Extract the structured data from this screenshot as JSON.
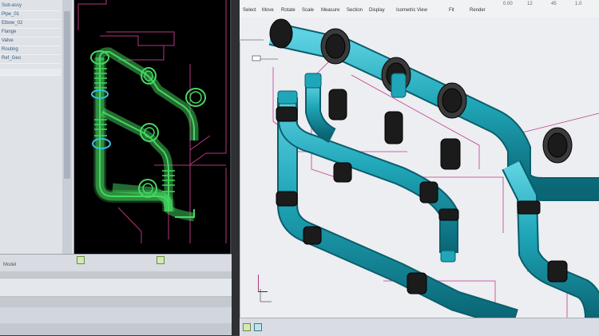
{
  "tree_panel": {
    "rows": [
      "Sub-assy",
      "Pipe_01",
      "Elbow_02",
      "Flange",
      "Valve",
      "Routing",
      "Ref_Geo"
    ],
    "bottom_text": "Model"
  },
  "viewport_top_bar": {
    "labels": [
      "Select",
      "Move",
      "Rotate",
      "Scale",
      "Measure",
      "Section",
      "Display",
      "Isometric View",
      "Fit",
      "Render"
    ],
    "values": [
      "0.00",
      "12",
      "45",
      "1.0"
    ]
  },
  "icons": [
    "axis-triad-icon",
    "snap-icon",
    "grid-icon",
    "pipe-icon"
  ],
  "colors": {
    "pipe": "#1fa6b8",
    "pipe_dark": "#0f7686",
    "fitting": "#1b1b1b",
    "wire": "#4ee06b",
    "magenta_lines": "#c23a8e",
    "viewport_bg": "#eceef1"
  }
}
